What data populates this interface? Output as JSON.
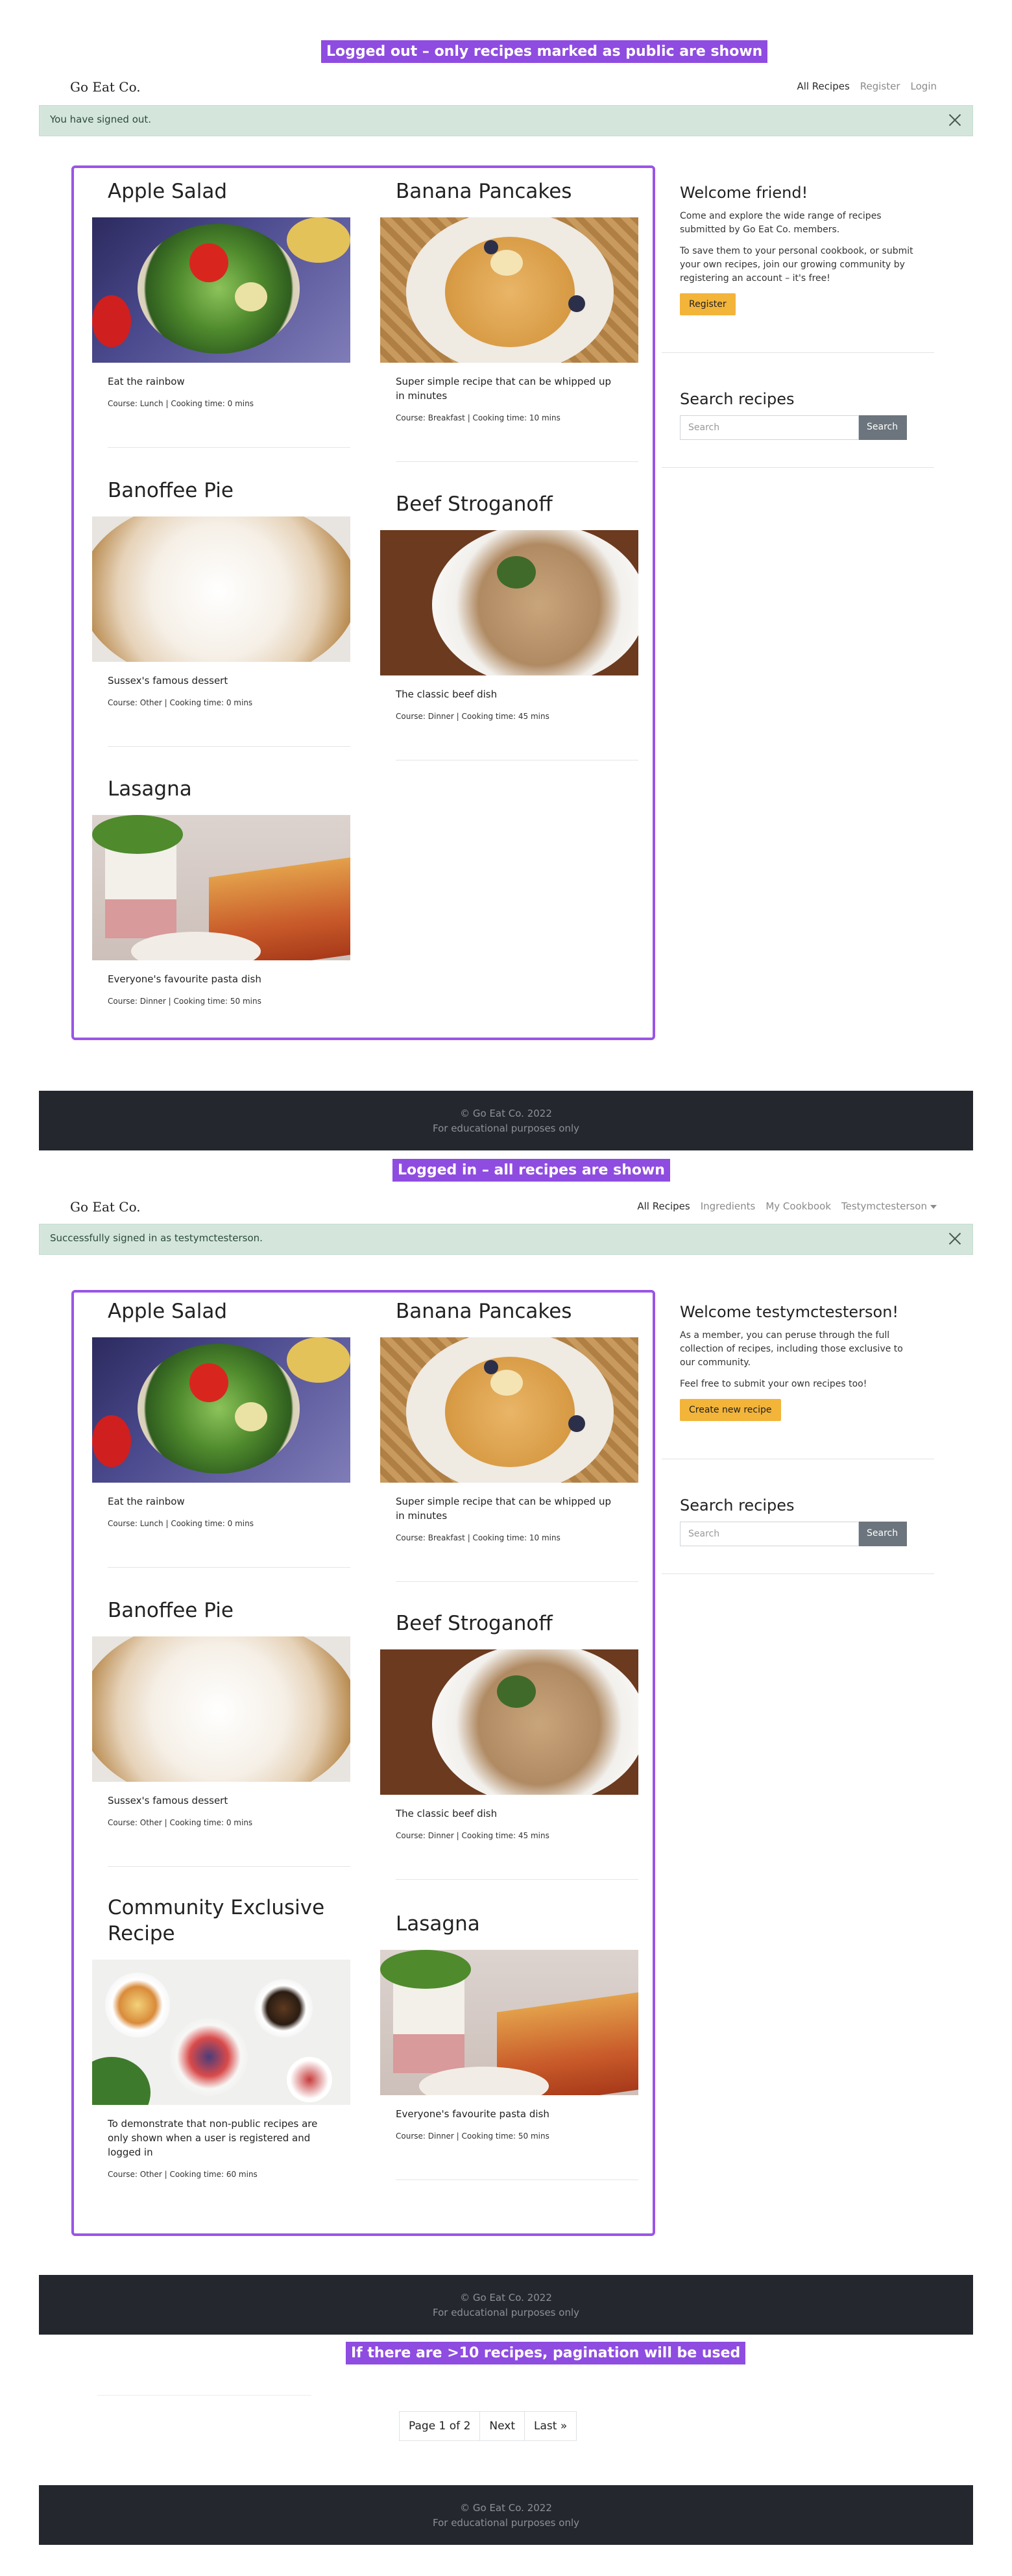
{
  "callouts": {
    "logged_out": "Logged out – only recipes marked as public are shown",
    "logged_in": "Logged in – all recipes are shown",
    "pagination": "If there are >10 recipes, pagination will be used"
  },
  "brand": "Go Eat Co.",
  "section1": {
    "nav": [
      "All Recipes",
      "Register",
      "Login"
    ],
    "alert": "You have signed out.",
    "sidebar": {
      "welcome": "Welcome friend!",
      "p1": "Come and explore the wide range of recipes submitted by Go Eat Co. members.",
      "p2": "To save them to your personal cookbook, or submit your own recipes, join our growing community by registering an account – it's free!",
      "button": "Register"
    },
    "recipes": [
      {
        "title": "Apple Salad",
        "desc": "Eat the rainbow",
        "meta": "Course: Lunch | Cooking time: 0 mins"
      },
      {
        "title": "Banana Pancakes",
        "desc": "Super simple recipe that can be whipped up in minutes",
        "meta": "Course: Breakfast | Cooking time: 10 mins"
      },
      {
        "title": "Banoffee Pie",
        "desc": "Sussex's famous dessert",
        "meta": "Course: Other | Cooking time: 0 mins"
      },
      {
        "title": "Beef Stroganoff",
        "desc": "The classic beef dish",
        "meta": "Course: Dinner | Cooking time: 45 mins"
      },
      {
        "title": "Lasagna",
        "desc": "Everyone's favourite pasta dish",
        "meta": "Course: Dinner | Cooking time: 50 mins"
      }
    ]
  },
  "section2": {
    "nav": [
      "All Recipes",
      "Ingredients",
      "My Cookbook",
      "Testymctesterson"
    ],
    "alert": "Successfully signed in as testymctesterson.",
    "sidebar": {
      "welcome": "Welcome testymctesterson!",
      "p1": "As a member, you can peruse through the full collection of recipes, including those exclusive to our community.",
      "p2": "Feel free to submit your own recipes too!",
      "button": "Create new recipe"
    },
    "recipes": [
      {
        "title": "Apple Salad",
        "desc": "Eat the rainbow",
        "meta": "Course: Lunch | Cooking time: 0 mins"
      },
      {
        "title": "Banana Pancakes",
        "desc": "Super simple recipe that can be whipped up in minutes",
        "meta": "Course: Breakfast | Cooking time: 10 mins"
      },
      {
        "title": "Banoffee Pie",
        "desc": "Sussex's famous dessert",
        "meta": "Course: Other | Cooking time: 0 mins"
      },
      {
        "title": "Beef Stroganoff",
        "desc": "The classic beef dish",
        "meta": "Course: Dinner | Cooking time: 45 mins"
      },
      {
        "title": "Community Exclusive Recipe",
        "desc": "To demonstrate that non-public recipes are only shown when a user is registered and logged in",
        "meta": "Course: Other | Cooking time: 60 mins"
      },
      {
        "title": "Lasagna",
        "desc": "Everyone's favourite pasta dish",
        "meta": "Course: Dinner | Cooking time: 50 mins"
      }
    ]
  },
  "search": {
    "title": "Search recipes",
    "placeholder": "Search",
    "button": "Search"
  },
  "footer": {
    "line1": "© Go Eat Co. 2022",
    "line2": "For educational purposes only"
  },
  "pagination": {
    "page": "Page 1 of 2",
    "next": "Next",
    "last": "Last »"
  },
  "colors": {
    "accent": "#8f4ce0",
    "button": "#f3b43a",
    "alert": "#d4e6dc",
    "footer": "#24272d"
  }
}
